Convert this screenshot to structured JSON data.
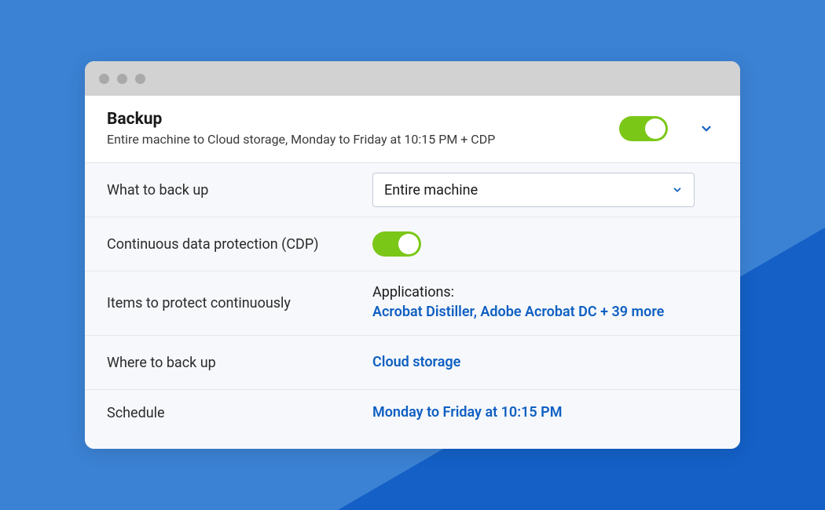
{
  "header": {
    "title": "Backup",
    "subtitle": "Entire machine to Cloud storage, Monday to Friday at 10:15 PM + CDP"
  },
  "rows": {
    "what_to_backup": {
      "label": "What to back up",
      "value": "Entire machine"
    },
    "cdp": {
      "label": "Continuous data protection (CDP)"
    },
    "items": {
      "label": "Items to protect continuously",
      "apps_label": "Applications:",
      "apps_value": "Acrobat Distiller, Adobe Acrobat DC + 39 more"
    },
    "where": {
      "label": "Where to back up",
      "value": "Cloud storage"
    },
    "schedule": {
      "label": "Schedule",
      "value": "Monday to Friday at 10:15 PM"
    }
  }
}
